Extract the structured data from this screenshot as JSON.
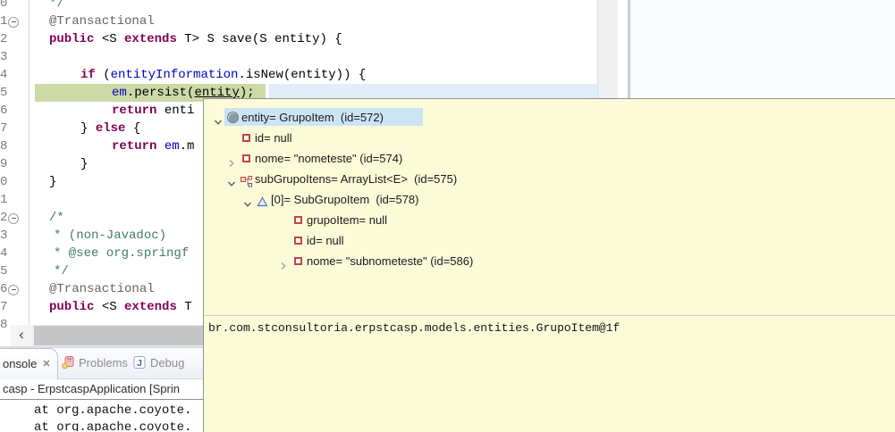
{
  "colors": {
    "keyword": "#7F0055",
    "annotation": "#646464",
    "comment": "#3F7F5F",
    "field_ref": "#0000C0",
    "debug_line_highlight": "#cdd9a6",
    "current_line_highlight": "#e2edfa",
    "popup_background": "#fbfbd8",
    "tree_selection": "#cde4f5"
  },
  "icons": {
    "scroll_left": "‹",
    "close": "✕"
  },
  "editor": {
    "lines": [
      {
        "n": "0",
        "ind": 55,
        "toks": [
          [
            "com",
            "*/"
          ]
        ]
      },
      {
        "n": "1",
        "fold": true,
        "ind": 55,
        "toks": [
          [
            "ann",
            "@Transactional"
          ]
        ]
      },
      {
        "n": "2",
        "ind": 55,
        "toks": [
          [
            "kw",
            "public"
          ],
          [
            "plain",
            " <S "
          ],
          [
            "kw",
            "extends"
          ],
          [
            "plain",
            " T> S save(S entity) {"
          ]
        ]
      },
      {
        "n": "3",
        "ind": 55,
        "toks": []
      },
      {
        "n": "4",
        "ind": 90,
        "toks": [
          [
            "kw",
            "if"
          ],
          [
            "plain",
            " ("
          ],
          [
            "field",
            "entityInformation"
          ],
          [
            "plain",
            ".isNew(entity)) {"
          ]
        ]
      },
      {
        "n": "5",
        "ind": 125,
        "hl": true,
        "toks": [
          [
            "field",
            "em"
          ],
          [
            "plain",
            ".persist("
          ],
          [
            "plain-u",
            "entity"
          ],
          [
            "plain",
            ");"
          ]
        ]
      },
      {
        "n": "6",
        "ind": 125,
        "toks": [
          [
            "kw",
            "return"
          ],
          [
            "plain",
            " enti"
          ]
        ]
      },
      {
        "n": "7",
        "ind": 90,
        "toks": [
          [
            "plain",
            "} "
          ],
          [
            "kw",
            "else"
          ],
          [
            "plain",
            " {"
          ]
        ]
      },
      {
        "n": "8",
        "ind": 125,
        "toks": [
          [
            "kw",
            "return"
          ],
          [
            "plain",
            " "
          ],
          [
            "field",
            "em"
          ],
          [
            "plain",
            ".m"
          ]
        ]
      },
      {
        "n": "9",
        "ind": 90,
        "toks": [
          [
            "plain",
            "}"
          ]
        ]
      },
      {
        "n": "0",
        "ind": 55,
        "toks": [
          [
            "plain",
            "}"
          ]
        ]
      },
      {
        "n": "1",
        "ind": 55,
        "toks": []
      },
      {
        "n": "2",
        "fold": true,
        "ind": 55,
        "toks": [
          [
            "com",
            "/*"
          ]
        ]
      },
      {
        "n": "3",
        "ind": 60,
        "toks": [
          [
            "com",
            "* (non-Javadoc)"
          ]
        ]
      },
      {
        "n": "4",
        "ind": 60,
        "toks": [
          [
            "com",
            "* @see org.springf"
          ]
        ]
      },
      {
        "n": "5",
        "ind": 60,
        "toks": [
          [
            "com",
            "*/"
          ]
        ]
      },
      {
        "n": "6",
        "fold": true,
        "ind": 55,
        "toks": [
          [
            "ann",
            "@Transactional"
          ]
        ]
      },
      {
        "n": "7",
        "ind": 55,
        "toks": [
          [
            "kw",
            "public"
          ],
          [
            "plain",
            " <S "
          ],
          [
            "kw",
            "extends"
          ],
          [
            "plain",
            " T"
          ]
        ]
      },
      {
        "n": "8",
        "ind": 55,
        "toks": []
      }
    ]
  },
  "popup": {
    "tree": [
      {
        "depth": 0,
        "state": "open",
        "icon": "variable",
        "label": "entity= GrupoItem  (id=572)",
        "selected": true
      },
      {
        "depth": 1,
        "state": "leaf",
        "icon": "field",
        "label": "id= null"
      },
      {
        "depth": 1,
        "state": "closed",
        "icon": "field",
        "label": "nome= \"nometeste\" (id=574)"
      },
      {
        "depth": 1,
        "state": "open",
        "icon": "list",
        "label": "subGrupoItens= ArrayList<E>  (id=575)"
      },
      {
        "depth": 2,
        "state": "open",
        "icon": "element",
        "label": "[0]= SubGrupoItem  (id=578)"
      },
      {
        "depth": 3,
        "state": "leaf",
        "icon": "field",
        "label": "grupoItem= null"
      },
      {
        "depth": 3,
        "state": "leaf",
        "icon": "field",
        "label": "id= null"
      },
      {
        "depth": 3,
        "state": "closed",
        "icon": "field",
        "label": "nome= \"subnometeste\" (id=586)"
      }
    ],
    "detail": "br.com.stconsultoria.erpstcasp.models.entities.GrupoItem@1f"
  },
  "console": {
    "tabs": [
      {
        "label": "onsole",
        "active": true,
        "closable": true
      },
      {
        "label": "Problems",
        "icon": "problems"
      },
      {
        "label": "Debug",
        "icon": "debug"
      }
    ],
    "title": "casp - ErpstcaspApplication [Sprin",
    "output": [
      "at org.apache.coyote.",
      "at org.apache.coyote."
    ]
  }
}
